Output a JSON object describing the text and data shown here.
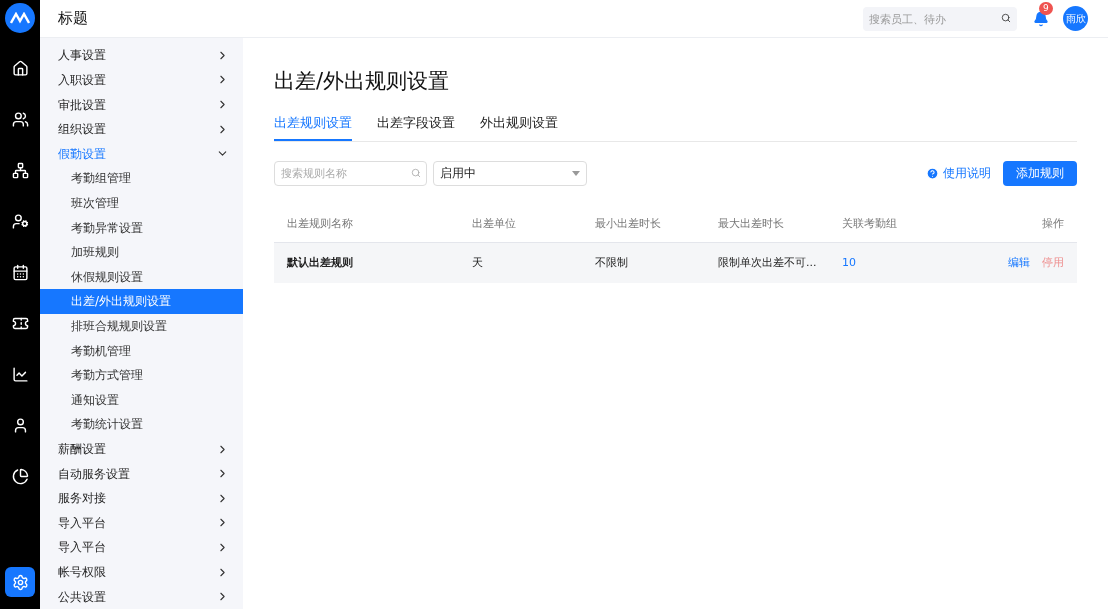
{
  "header": {
    "title": "标题",
    "search": {
      "placeholder": "搜索员工、待办"
    },
    "notifications": "9",
    "avatar": "雨欣"
  },
  "rail": [
    {
      "selected": false
    },
    {
      "selected": false
    },
    {
      "selected": false
    },
    {
      "selected": false
    },
    {
      "selected": false
    },
    {
      "selected": false
    },
    {
      "selected": false
    },
    {
      "selected": false
    },
    {
      "selected": false
    },
    {
      "selected": true
    }
  ],
  "sidebar": {
    "items": [
      {
        "label": "人事设置",
        "expanded": false
      },
      {
        "label": "入职设置",
        "expanded": false
      },
      {
        "label": "审批设置",
        "expanded": false
      },
      {
        "label": "组织设置",
        "expanded": false
      },
      {
        "label": "假勤设置",
        "expanded": true,
        "children": [
          {
            "label": "考勤组管理",
            "selected": false
          },
          {
            "label": "班次管理",
            "selected": false
          },
          {
            "label": "考勤异常设置",
            "selected": false
          },
          {
            "label": "加班规则",
            "selected": false
          },
          {
            "label": "休假规则设置",
            "selected": false
          },
          {
            "label": "出差/外出规则设置",
            "selected": true
          },
          {
            "label": "排班合规规则设置",
            "selected": false
          },
          {
            "label": "考勤机管理",
            "selected": false
          },
          {
            "label": "考勤方式管理",
            "selected": false
          },
          {
            "label": "通知设置",
            "selected": false
          },
          {
            "label": "考勤统计设置",
            "selected": false
          }
        ]
      },
      {
        "label": "薪酬设置",
        "expanded": false
      },
      {
        "label": "自动服务设置",
        "expanded": false
      },
      {
        "label": "服务对接",
        "expanded": false
      },
      {
        "label": "导入平台",
        "expanded": false
      },
      {
        "label": "导入平台",
        "expanded": false
      },
      {
        "label": "帐号权限",
        "expanded": false
      },
      {
        "label": "公共设置",
        "expanded": false
      }
    ]
  },
  "page": {
    "title": "出差/外出规则设置",
    "tabs": [
      {
        "label": "出差规则设置",
        "selected": true
      },
      {
        "label": "出差字段设置",
        "selected": false
      },
      {
        "label": "外出规则设置",
        "selected": false
      }
    ],
    "search": {
      "placeholder": "搜索规则名称"
    },
    "status_select": "启用中",
    "help_link": "使用说明",
    "add_button": "添加规则",
    "table": {
      "columns": [
        "出差规则名称",
        "出差单位",
        "最小出差时长",
        "最大出差时长",
        "关联考勤组",
        "操作"
      ],
      "rows": [
        {
          "name": "默认出差规则",
          "unit": "天",
          "min": "不限制",
          "max": "限制单次出差不可...",
          "groups": "10",
          "actions": [
            {
              "label": "编辑",
              "kind": "edit"
            },
            {
              "label": "停用",
              "kind": "disable"
            }
          ]
        }
      ]
    }
  }
}
